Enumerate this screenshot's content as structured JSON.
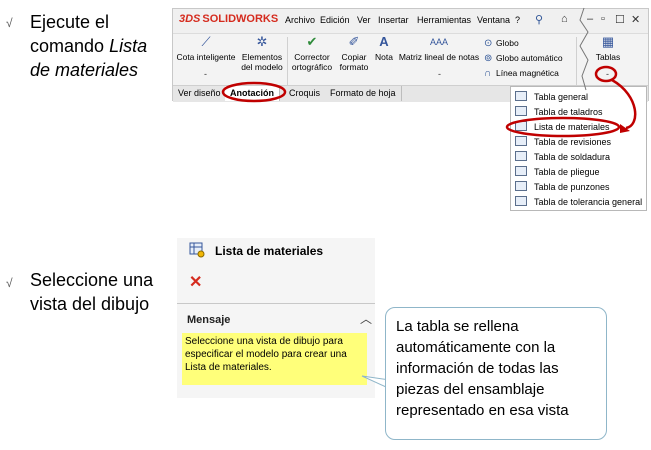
{
  "steps": [
    {
      "bullet": "√",
      "line1": "Ejecute el",
      "line2_plain": "comando ",
      "line2_italic": "Lista",
      "line3_italic": "de materiales"
    },
    {
      "bullet": "√",
      "line1": "Seleccione una",
      "line2": "vista del dibujo"
    }
  ],
  "ribbon": {
    "logo": "SOLIDWORKS",
    "logo_prefix": "3DS",
    "menu": [
      "Archivo",
      "Edición",
      "Ver",
      "Insertar",
      "Herramientas",
      "Ventana",
      "?"
    ],
    "buttons": {
      "cota": "Cota inteligente",
      "elementos_1": "Elementos",
      "elementos_2": "del modelo",
      "corrector_1": "Corrector",
      "corrector_2": "ortográfico",
      "copiar_1": "Copiar",
      "copiar_2": "formato",
      "nota": "Nota",
      "matriz": "Matriz lineal de notas",
      "globo": "Globo",
      "globo_auto": "Globo automático",
      "linea": "Línea magnética",
      "tablas": "Tablas"
    },
    "tabs": [
      "Ver diseño",
      "Anotación",
      "Croquis",
      "Formato de hoja"
    ],
    "active_tab": "Anotación"
  },
  "dropdown": {
    "items": [
      "Tabla general",
      "Tabla de taladros",
      "Lista de materiales",
      "Tabla de revisiones",
      "Tabla de soldadura",
      "Tabla de pliegue",
      "Tabla de punzones",
      "Tabla de tolerancia general"
    ],
    "highlighted": "Lista de materiales"
  },
  "property_manager": {
    "title": "Lista de materiales",
    "close_glyph": "✕",
    "message_header": "Mensaje",
    "message": "Seleccione una vista de dibujo para especificar el modelo para crear una Lista de materiales."
  },
  "callout": {
    "text": "La tabla se rellena automáticamente con la información de todas las piezas del ensamblaje representado en esa vista"
  },
  "colors": {
    "highlight_circle": "#c00000",
    "logo": "#d52b1e",
    "message_bg": "#ffff7a",
    "callout_border": "#8fb6c9"
  }
}
